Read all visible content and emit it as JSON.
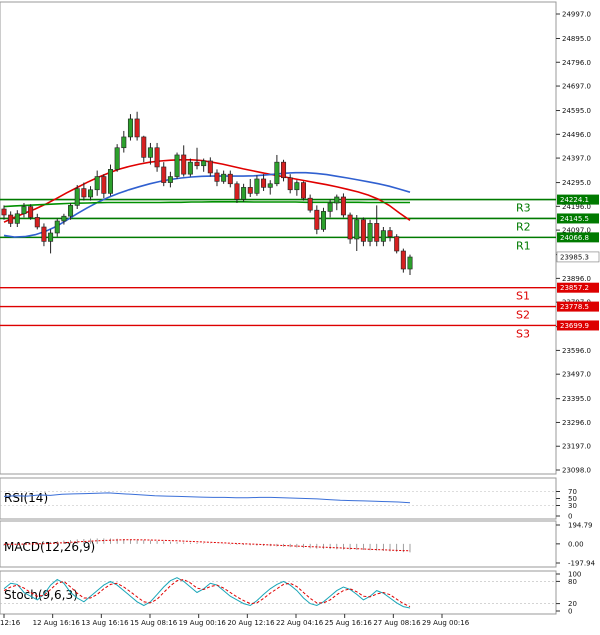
{
  "chart_data": {
    "type": "candlestick",
    "price_axis": {
      "range": [
        23098.0,
        24997.0
      ],
      "ticks": [
        "24997.0",
        "24895.0",
        "24796.0",
        "24697.0",
        "24595.0",
        "24496.0",
        "24397.0",
        "24295.0",
        "24196.0",
        "24097.0",
        "23995.0",
        "23896.0",
        "23797.0",
        "23695.0",
        "23596.0",
        "23497.0",
        "23395.0",
        "23296.0",
        "23197.0",
        "23098.0"
      ]
    },
    "time_axis": {
      "labels": [
        "12:16",
        "12 Aug 16:16",
        "13 Aug 16:16",
        "15 Aug 08:16",
        "19 Aug 00:16",
        "20 Aug 12:16",
        "22 Aug 04:16",
        "25 Aug 16:16",
        "27 Aug 08:16",
        "29 Aug 00:16"
      ]
    },
    "levels": [
      {
        "name": "R3",
        "value": 24224.1,
        "label": "24224.1",
        "color": "#007a00"
      },
      {
        "name": "R2",
        "value": 24145.5,
        "label": "24145.5",
        "color": "#007a00"
      },
      {
        "name": "R1",
        "value": 24066.8,
        "label": "24066.8",
        "color": "#007a00"
      },
      {
        "name": "S1",
        "value": 23857.2,
        "label": "23857.2",
        "color": "#dd0000"
      },
      {
        "name": "S2",
        "value": 23778.5,
        "label": "23778.5",
        "color": "#dd0000"
      },
      {
        "name": "S3",
        "value": 23699.9,
        "label": "23699.9",
        "color": "#dd0000"
      }
    ],
    "current_price": {
      "value": 23985.3,
      "label": "23985.3"
    },
    "candles": [
      [
        24185,
        24200,
        24140,
        24160
      ],
      [
        24160,
        24175,
        24110,
        24125
      ],
      [
        24125,
        24180,
        24110,
        24165
      ],
      [
        24165,
        24210,
        24150,
        24195
      ],
      [
        24195,
        24205,
        24140,
        24150
      ],
      [
        24150,
        24165,
        24100,
        24110
      ],
      [
        24110,
        24125,
        24030,
        24050
      ],
      [
        24050,
        24100,
        24000,
        24085
      ],
      [
        24085,
        24145,
        24070,
        24135
      ],
      [
        24135,
        24165,
        24120,
        24155
      ],
      [
        24155,
        24210,
        24140,
        24200
      ],
      [
        24200,
        24285,
        24185,
        24270
      ],
      [
        24270,
        24295,
        24220,
        24235
      ],
      [
        24235,
        24280,
        24220,
        24265
      ],
      [
        24265,
        24345,
        24240,
        24320
      ],
      [
        24320,
        24330,
        24230,
        24250
      ],
      [
        24250,
        24370,
        24240,
        24350
      ],
      [
        24350,
        24455,
        24340,
        24440
      ],
      [
        24440,
        24510,
        24420,
        24485
      ],
      [
        24485,
        24580,
        24470,
        24560
      ],
      [
        24560,
        24590,
        24470,
        24485
      ],
      [
        24485,
        24490,
        24380,
        24400
      ],
      [
        24400,
        24460,
        24370,
        24440
      ],
      [
        24440,
        24460,
        24340,
        24360
      ],
      [
        24360,
        24380,
        24280,
        24295
      ],
      [
        24295,
        24340,
        24275,
        24320
      ],
      [
        24320,
        24420,
        24310,
        24410
      ],
      [
        24410,
        24450,
        24320,
        24330
      ],
      [
        24330,
        24395,
        24320,
        24380
      ],
      [
        24380,
        24440,
        24350,
        24365
      ],
      [
        24365,
        24395,
        24340,
        24385
      ],
      [
        24385,
        24400,
        24320,
        24335
      ],
      [
        24335,
        24350,
        24280,
        24300
      ],
      [
        24300,
        24345,
        24290,
        24330
      ],
      [
        24330,
        24345,
        24275,
        24290
      ],
      [
        24290,
        24300,
        24210,
        24225
      ],
      [
        24225,
        24290,
        24215,
        24275
      ],
      [
        24275,
        24310,
        24235,
        24250
      ],
      [
        24250,
        24325,
        24240,
        24310
      ],
      [
        24310,
        24330,
        24260,
        24275
      ],
      [
        24275,
        24305,
        24245,
        24290
      ],
      [
        24290,
        24410,
        24280,
        24380
      ],
      [
        24380,
        24390,
        24300,
        24315
      ],
      [
        24315,
        24330,
        24250,
        24265
      ],
      [
        24265,
        24305,
        24240,
        24295
      ],
      [
        24295,
        24300,
        24220,
        24230
      ],
      [
        24230,
        24245,
        24170,
        24180
      ],
      [
        24180,
        24200,
        24080,
        24100
      ],
      [
        24100,
        24190,
        24090,
        24175
      ],
      [
        24175,
        24225,
        24150,
        24210
      ],
      [
        24210,
        24245,
        24180,
        24235
      ],
      [
        24235,
        24250,
        24150,
        24160
      ],
      [
        24160,
        24170,
        24040,
        24060
      ],
      [
        24060,
        24160,
        24010,
        24140
      ],
      [
        24140,
        24150,
        24030,
        24050
      ],
      [
        24050,
        24140,
        24030,
        24125
      ],
      [
        24125,
        24200,
        24030,
        24050
      ],
      [
        24050,
        24110,
        24030,
        24095
      ],
      [
        24095,
        24110,
        24050,
        24070
      ],
      [
        24070,
        24080,
        24000,
        24010
      ],
      [
        24010,
        24020,
        23920,
        23935
      ],
      [
        23935,
        23995,
        23910,
        23985
      ]
    ],
    "series": [
      {
        "name": "",
        "color": "#e00000",
        "values": [
          24130,
          24150,
          24168,
          24185,
          24205,
          24228,
          24252,
          24274,
          24296,
          24316,
          24334,
          24350,
          24362,
          24372,
          24380,
          24385,
          24388,
          24390,
          24390,
          24387,
          24380,
          24372,
          24362,
          24352,
          24343,
          24334,
          24326,
          24318,
          24310,
          24302,
          24294,
          24286,
          24277,
          24267,
          24256,
          24243,
          24225,
          24200,
          24168,
          24138
        ]
      },
      {
        "name": "",
        "color": "#3060d0",
        "values": [
          24075,
          24068,
          24070,
          24078,
          24092,
          24112,
          24138,
          24165,
          24190,
          24213,
          24233,
          24250,
          24265,
          24278,
          24290,
          24300,
          24308,
          24314,
          24318,
          24321,
          24322,
          24322,
          24322,
          24322,
          24323,
          24326,
          24330,
          24334,
          24336,
          24336,
          24333,
          24328,
          24321,
          24314,
          24306,
          24298,
          24290,
          24280,
          24268,
          24255
        ]
      },
      {
        "name": "",
        "color": "#009000",
        "values": [
          24195,
          24198,
          24200,
          24202,
          24204,
          24206,
          24208,
          24209,
          24210,
          24211,
          24212,
          24212,
          24212,
          24212,
          24212,
          24212,
          24213,
          24213,
          24214,
          24214,
          24215,
          24215,
          24215,
          24215,
          24214,
          24214,
          24214,
          24214,
          24214,
          24213,
          24213,
          24213,
          24213,
          24213,
          24213,
          24212,
          24212,
          24212,
          24212,
          24212
        ]
      }
    ],
    "rsi": {
      "label": "RSI(14)",
      "ticks": [
        "70",
        "50",
        "30",
        "0"
      ],
      "range": [
        0,
        100
      ],
      "levels": [
        70,
        30
      ],
      "values": [
        56,
        58,
        57,
        60,
        59,
        62,
        63,
        64,
        65,
        66,
        64,
        62,
        60,
        58,
        57,
        56,
        55,
        54,
        53,
        53,
        52,
        52,
        53,
        53,
        52,
        51,
        50,
        49,
        47,
        45,
        44,
        43,
        42,
        41,
        40,
        38
      ]
    },
    "macd": {
      "label": "MACD(12,26,9)",
      "ticks": [
        "194.79",
        "0.00",
        "-197.94"
      ],
      "range": [
        -197.94,
        194.79
      ],
      "histogram": [
        -20,
        -15,
        -10,
        -5,
        0,
        6,
        12,
        20,
        28,
        35,
        40,
        46,
        50,
        54,
        56,
        56,
        55,
        53,
        50,
        46,
        42,
        38,
        34,
        30,
        26,
        22,
        18,
        15,
        12,
        9,
        6,
        3,
        0,
        -3,
        -6,
        -9,
        -12,
        -15,
        -18,
        -21,
        -24,
        -27,
        -30,
        -34,
        -38,
        -42,
        -46,
        -50,
        -52,
        -54,
        -56,
        -58,
        -60,
        -62,
        -64,
        -66,
        -70,
        -74,
        -78,
        -82,
        -86,
        -88
      ],
      "signal": [
        -5,
        -5,
        -4,
        -3,
        -2,
        0,
        2,
        5,
        8,
        12,
        16,
        20,
        24,
        28,
        32,
        35,
        38,
        40,
        42,
        42,
        42,
        41,
        40,
        38,
        36,
        34,
        31,
        28,
        25,
        22,
        19,
        16,
        13,
        10,
        7,
        4,
        1,
        -2,
        -5,
        -8,
        -11,
        -14,
        -17,
        -20,
        -23,
        -26,
        -29,
        -32,
        -35,
        -38,
        -41,
        -44,
        -47,
        -50,
        -53,
        -56,
        -59,
        -62,
        -65,
        -68,
        -70,
        -72
      ]
    },
    "stoch": {
      "label": "Stoch(9,6,3)",
      "ticks": [
        "100",
        "80",
        "20",
        "0"
      ],
      "range": [
        0,
        100
      ],
      "levels": [
        80,
        20
      ],
      "k": [
        60,
        75,
        72,
        50,
        40,
        30,
        45,
        70,
        85,
        75,
        50,
        35,
        25,
        40,
        55,
        70,
        80,
        70,
        55,
        40,
        25,
        15,
        25,
        45,
        65,
        82,
        90,
        80,
        65,
        50,
        60,
        75,
        70,
        55,
        40,
        30,
        20,
        15,
        28,
        45,
        60,
        72,
        80,
        70,
        55,
        35,
        20,
        15,
        25,
        40,
        55,
        65,
        58,
        45,
        30,
        40,
        55,
        48,
        35,
        22,
        12,
        8
      ],
      "d": [
        55,
        65,
        70,
        62,
        50,
        40,
        42,
        58,
        75,
        80,
        65,
        48,
        35,
        35,
        45,
        60,
        72,
        75,
        65,
        52,
        38,
        25,
        22,
        32,
        50,
        68,
        82,
        85,
        76,
        62,
        58,
        66,
        70,
        62,
        50,
        38,
        28,
        20,
        22,
        34,
        48,
        60,
        72,
        75,
        66,
        50,
        34,
        22,
        22,
        30,
        44,
        55,
        60,
        52,
        40,
        38,
        46,
        50,
        44,
        32,
        20,
        12
      ]
    }
  }
}
